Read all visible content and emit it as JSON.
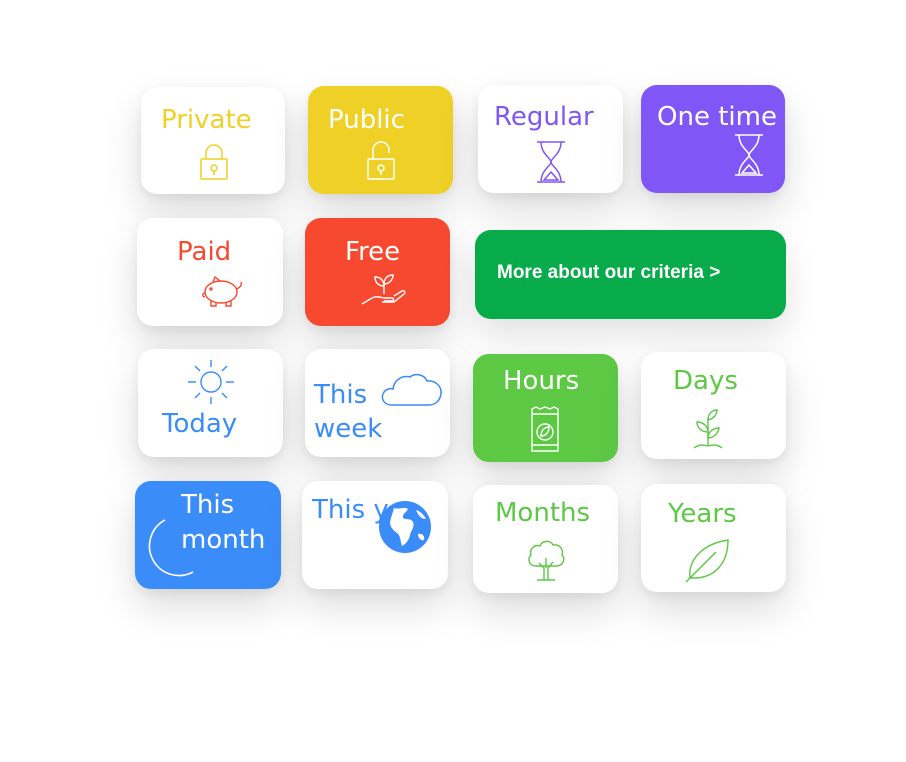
{
  "colors": {
    "yellow": "#EFD026",
    "purple": "#8057F6",
    "red": "#F6492F",
    "green_cta": "#07AB4A",
    "green": "#5CC844",
    "blue": "#3A8CF8"
  },
  "cards": {
    "private": {
      "label": "Private",
      "icon": "padlock-closed-icon"
    },
    "public": {
      "label": "Public",
      "icon": "padlock-open-icon"
    },
    "regular": {
      "label": "Regular",
      "icon": "hourglass-icon"
    },
    "one_time": {
      "label": "One time",
      "icon": "hourglass-icon"
    },
    "paid": {
      "label": "Paid",
      "icon": "piggy-bank-icon"
    },
    "free": {
      "label": "Free",
      "icon": "hand-sprout-icon"
    },
    "today": {
      "label": "Today",
      "icon": "sun-icon"
    },
    "this_week": {
      "label_line1": "This",
      "label_line2": "week",
      "icon": "cloud-icon"
    },
    "hours": {
      "label": "Hours",
      "icon": "seed-packet-icon"
    },
    "days": {
      "label": "Days",
      "icon": "seedling-icon"
    },
    "this_month": {
      "label_line1": "This",
      "label_line2": "month",
      "icon": "crescent-moon-icon"
    },
    "this_year": {
      "label": "This ye",
      "icon": "globe-icon"
    },
    "months": {
      "label": "Months",
      "icon": "tree-icon"
    },
    "years": {
      "label": "Years",
      "icon": "leaf-icon"
    }
  },
  "cta": {
    "label": "More about our criteria >"
  }
}
